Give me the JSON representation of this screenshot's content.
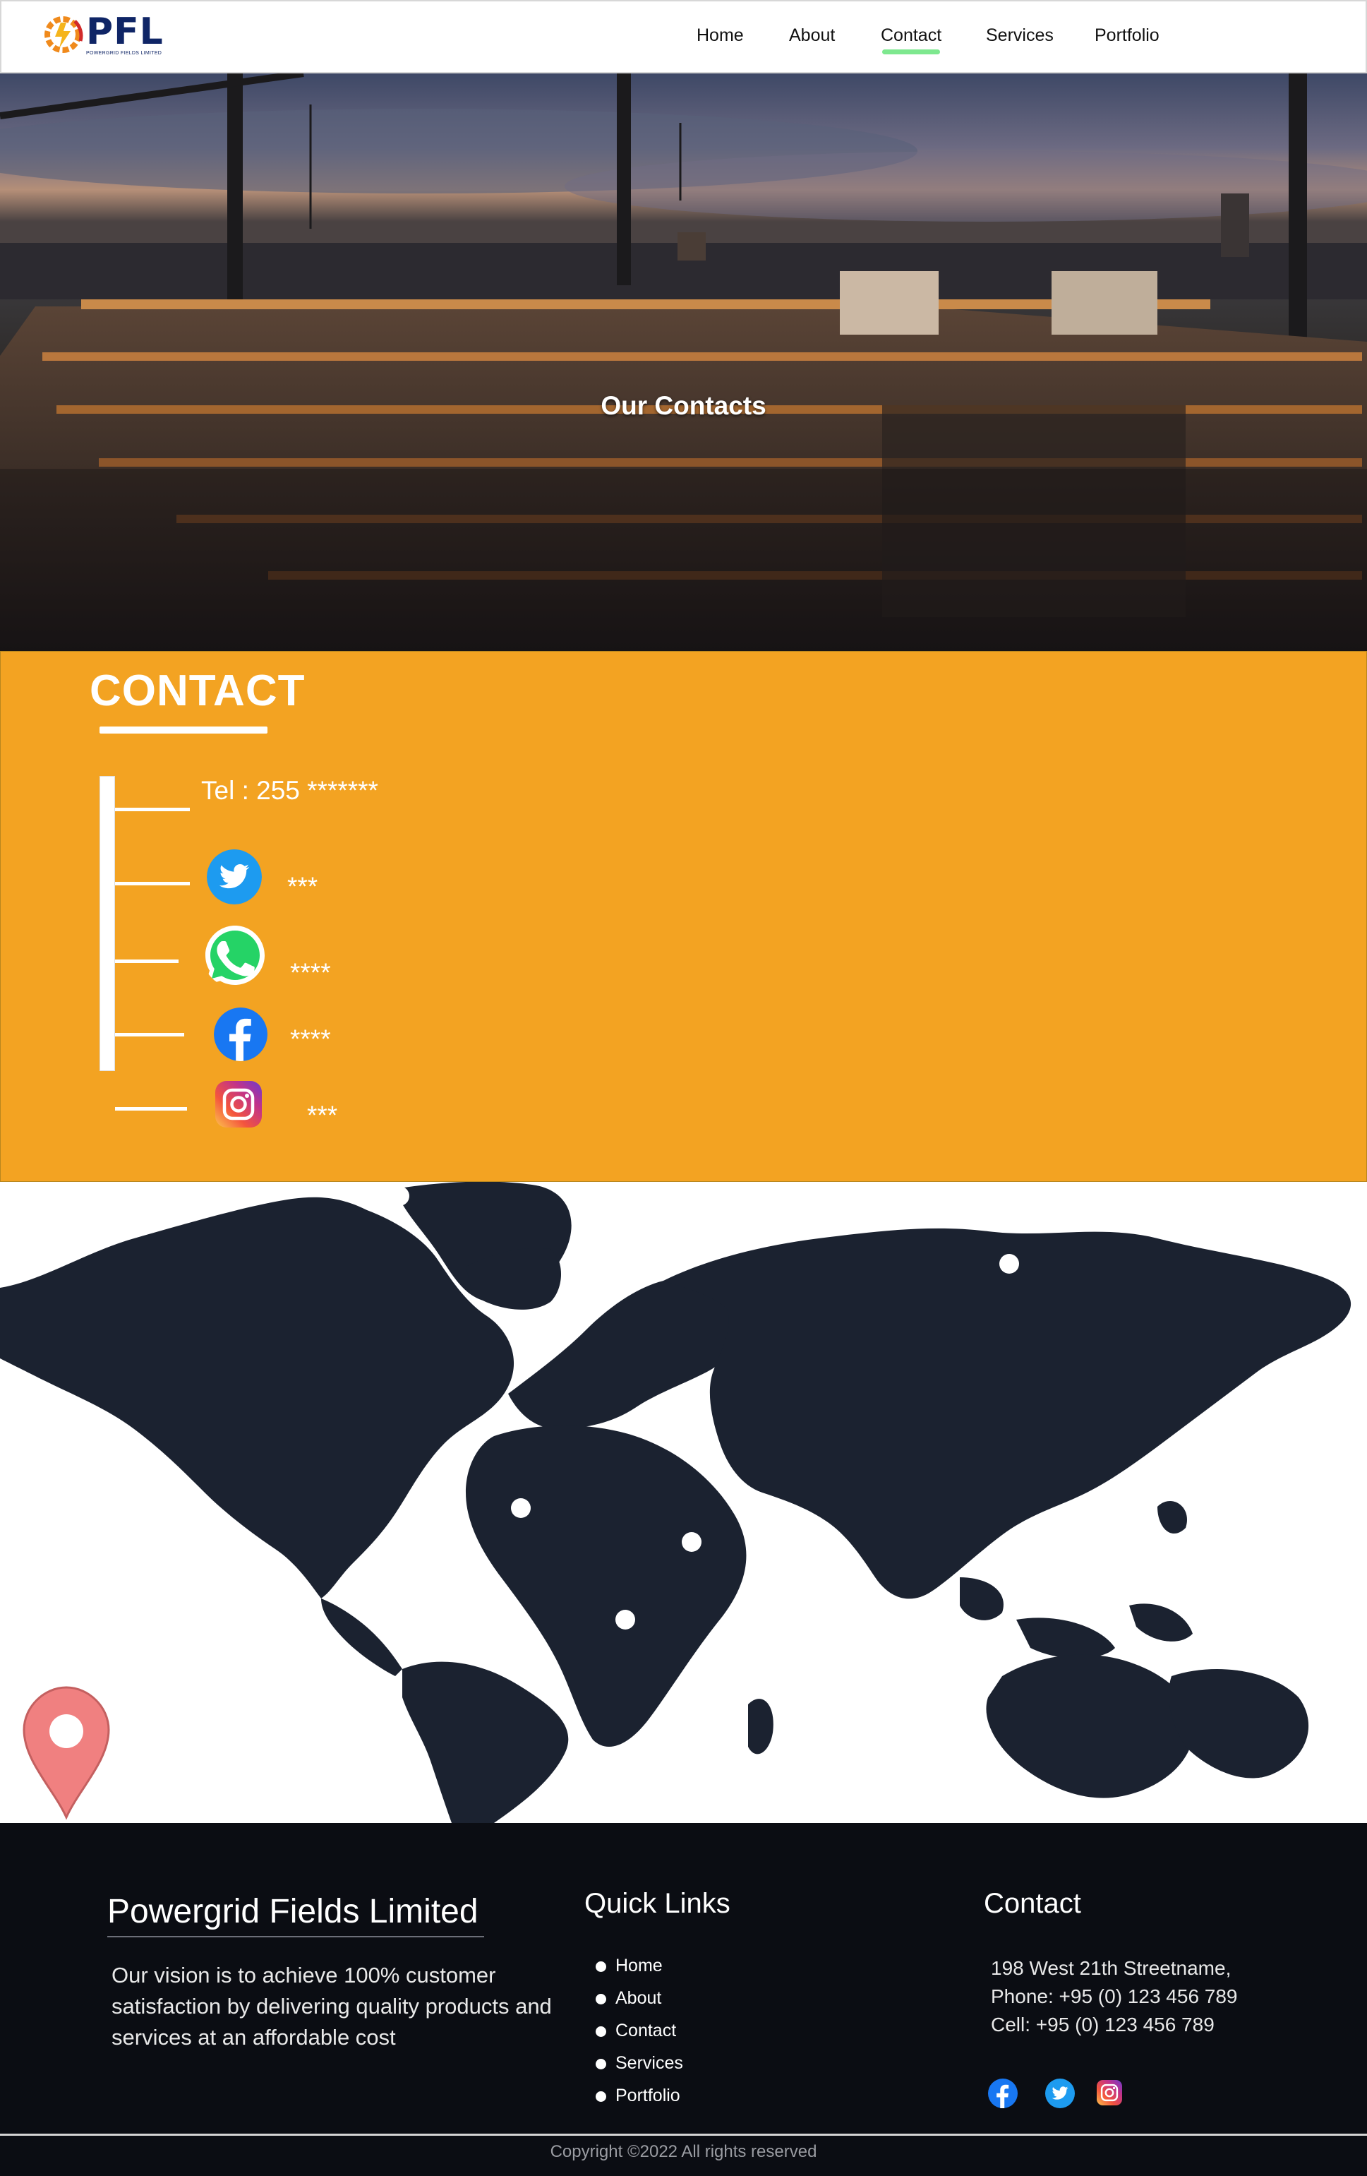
{
  "brand": {
    "logo_text": "PFL",
    "logo_subtitle": "POWERGRID FIELDS LIMITED"
  },
  "nav": {
    "items": [
      {
        "label": "Home",
        "active": false
      },
      {
        "label": "About",
        "active": false
      },
      {
        "label": "Contact",
        "active": true
      },
      {
        "label": "Services",
        "active": false
      },
      {
        "label": "Portfolio",
        "active": false
      }
    ]
  },
  "hero": {
    "title": "Our Contacts"
  },
  "contact": {
    "heading": "CONTACT",
    "tel": "Tel  : 255 *******",
    "twitter": "***",
    "whatsapp": "****",
    "facebook": "****",
    "instagram": "***"
  },
  "footer": {
    "brand": "Powergrid Fields Limited",
    "vision": "Our vision is to achieve 100% customer satisfaction by delivering quality products and services at an affordable cost",
    "quick_links_title": "Quick Links",
    "quick_links": [
      "Home",
      "About",
      "Contact",
      "Services",
      "Portfolio"
    ],
    "contact_title": "Contact",
    "address": "198 West 21th Streetname,",
    "phone": "Phone: +95 (0) 123 456 789",
    "cell": "Cell: +95 (0) 123 456 789",
    "copyright": "Copyright ©2022 All rights reserved"
  },
  "colors": {
    "accent_orange": "#f3a322",
    "nav_active_underline": "#7ee88f",
    "footer_bg": "#0b0d13",
    "brand_navy": "#0f2566",
    "map_land": "#1b2230",
    "pin_red": "#f08080"
  },
  "icons": {
    "twitter": "twitter-icon",
    "whatsapp": "whatsapp-icon",
    "facebook": "facebook-icon",
    "instagram": "instagram-icon",
    "map_pin": "location-pin-icon"
  }
}
